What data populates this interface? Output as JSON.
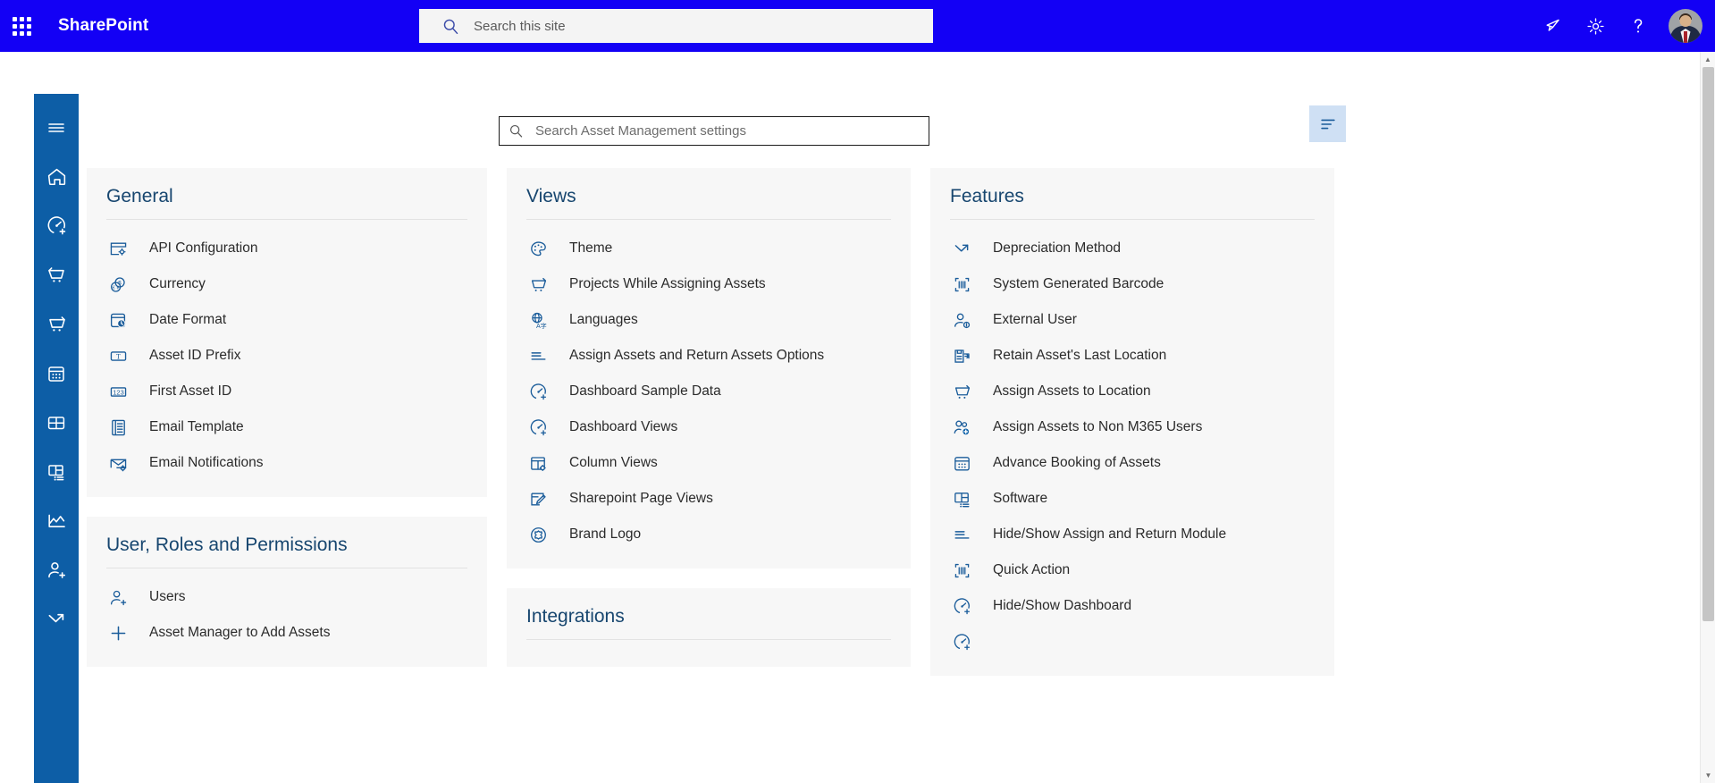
{
  "colors": {
    "header_bg": "#1300f5",
    "rail_bg": "#0d5ea6",
    "accent_title": "#17466f",
    "icon_blue": "#1a5c9a",
    "card_bg": "#f7f7f7",
    "filter_btn_bg": "#cfe0f4"
  },
  "header": {
    "brand": "SharePoint",
    "waffle_name": "app-launcher",
    "search": {
      "placeholder": "Search this site",
      "value": ""
    },
    "actions": [
      {
        "name": "announcements-icon",
        "label": "Announcements"
      },
      {
        "name": "gear-icon",
        "label": "Settings"
      },
      {
        "name": "help-icon",
        "label": "Help"
      }
    ],
    "avatar_label": "Account manager"
  },
  "rail": {
    "items": [
      {
        "name": "hamburger-menu-icon",
        "label": "Menu"
      },
      {
        "name": "home-icon",
        "label": "Home"
      },
      {
        "name": "dashboard-add-icon",
        "label": "Dashboard"
      },
      {
        "name": "return-cart-icon",
        "label": "Return Assets"
      },
      {
        "name": "assign-cart-icon",
        "label": "Assign Assets"
      },
      {
        "name": "booking-calendar-icon",
        "label": "Advance Booking"
      },
      {
        "name": "table-grid-icon",
        "label": "Assets Table"
      },
      {
        "name": "software-layout-icon",
        "label": "Software"
      },
      {
        "name": "line-chart-icon",
        "label": "Reports"
      },
      {
        "name": "user-add-icon",
        "label": "Users"
      },
      {
        "name": "depreciation-icon",
        "label": "Depreciation"
      }
    ]
  },
  "toolbar": {
    "settings_search": {
      "placeholder": "Search Asset Management settings",
      "value": ""
    },
    "filter_button": {
      "name": "filter-list-icon",
      "label": "Filter settings"
    }
  },
  "columns": [
    {
      "name": "column-left",
      "cards": [
        {
          "title": "General",
          "name": "card-general",
          "items": [
            {
              "label": "API Configuration",
              "icon": "api-configuration-icon"
            },
            {
              "label": "Currency",
              "icon": "currency-icon"
            },
            {
              "label": "Date Format",
              "icon": "date-format-icon"
            },
            {
              "label": "Asset ID Prefix",
              "icon": "text-prefix-icon"
            },
            {
              "label": "First Asset ID",
              "icon": "number-123-icon"
            },
            {
              "label": "Email Template",
              "icon": "email-template-icon"
            },
            {
              "label": "Email Notifications",
              "icon": "email-notification-icon"
            }
          ]
        },
        {
          "title": "User, Roles and Permissions",
          "name": "card-user-roles-permissions",
          "items": [
            {
              "label": "Users",
              "icon": "user-add-icon"
            },
            {
              "label": "Asset Manager to Add Assets",
              "icon": "plus-icon"
            }
          ]
        }
      ]
    },
    {
      "name": "column-middle",
      "cards": [
        {
          "title": "Views",
          "name": "card-views",
          "items": [
            {
              "label": "Theme",
              "icon": "palette-icon"
            },
            {
              "label": "Projects While Assigning Assets",
              "icon": "cart-icon"
            },
            {
              "label": "Languages",
              "icon": "language-globe-icon"
            },
            {
              "label": "Assign Assets and Return Assets Options",
              "icon": "options-lines-icon"
            },
            {
              "label": "Dashboard Sample Data",
              "icon": "dashboard-add-icon"
            },
            {
              "label": "Dashboard Views",
              "icon": "dashboard-add-icon"
            },
            {
              "label": "Column Views",
              "icon": "column-settings-icon"
            },
            {
              "label": "Sharepoint Page Views",
              "icon": "page-edit-icon"
            },
            {
              "label": "Brand Logo",
              "icon": "brand-logo-icon"
            }
          ]
        },
        {
          "title": "Integrations",
          "name": "card-integrations",
          "items": []
        }
      ]
    },
    {
      "name": "column-right",
      "cards": [
        {
          "title": "Features",
          "name": "card-features",
          "items": [
            {
              "label": "Depreciation Method",
              "icon": "depreciation-icon"
            },
            {
              "label": "System Generated Barcode",
              "icon": "barcode-scan-icon"
            },
            {
              "label": "External User",
              "icon": "external-user-icon"
            },
            {
              "label": "Retain Asset's Last Location",
              "icon": "retain-location-icon"
            },
            {
              "label": "Assign Assets to Location",
              "icon": "cart-icon"
            },
            {
              "label": "Assign Assets to Non M365 Users",
              "icon": "user-group-add-icon"
            },
            {
              "label": "Advance Booking of Assets",
              "icon": "booking-calendar-icon"
            },
            {
              "label": "Software",
              "icon": "software-layout-icon"
            },
            {
              "label": "Hide/Show Assign and Return Module",
              "icon": "options-lines-icon"
            },
            {
              "label": "Quick Action",
              "icon": "barcode-scan-icon"
            },
            {
              "label": "Hide/Show Dashboard",
              "icon": "dashboard-add-icon"
            }
          ]
        }
      ]
    }
  ],
  "scrollbar": {
    "up_arrow": "▲",
    "down_arrow": "▼"
  }
}
